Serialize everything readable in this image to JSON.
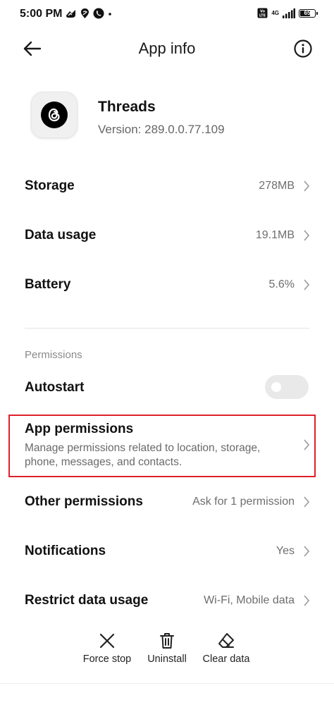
{
  "status_bar": {
    "time": "5:00 PM",
    "network_label": "4G",
    "battery_level": "65"
  },
  "header": {
    "title": "App info"
  },
  "app": {
    "name": "Threads",
    "version": "Version: 289.0.0.77.109",
    "icon": "threads-logo-icon"
  },
  "usage_rows": [
    {
      "label": "Storage",
      "value": "278MB"
    },
    {
      "label": "Data usage",
      "value": "19.1MB"
    },
    {
      "label": "Battery",
      "value": "5.6%"
    }
  ],
  "permissions_section": {
    "label": "Permissions",
    "autostart": {
      "label": "Autostart",
      "enabled": false
    },
    "app_permissions": {
      "label": "App permissions",
      "description": "Manage permissions related to location, storage, phone, messages, and contacts."
    },
    "other_permissions": {
      "label": "Other permissions",
      "value": "Ask for 1 permission"
    },
    "notifications": {
      "label": "Notifications",
      "value": "Yes"
    },
    "restrict_data": {
      "label": "Restrict data usage",
      "value": "Wi-Fi, Mobile data"
    }
  },
  "actions": [
    {
      "label": "Force stop",
      "icon": "close-icon"
    },
    {
      "label": "Uninstall",
      "icon": "trash-icon"
    },
    {
      "label": "Clear data",
      "icon": "eraser-icon"
    }
  ],
  "colors": {
    "highlight": "#e0202b",
    "secondary_text": "#6e6e6e"
  }
}
